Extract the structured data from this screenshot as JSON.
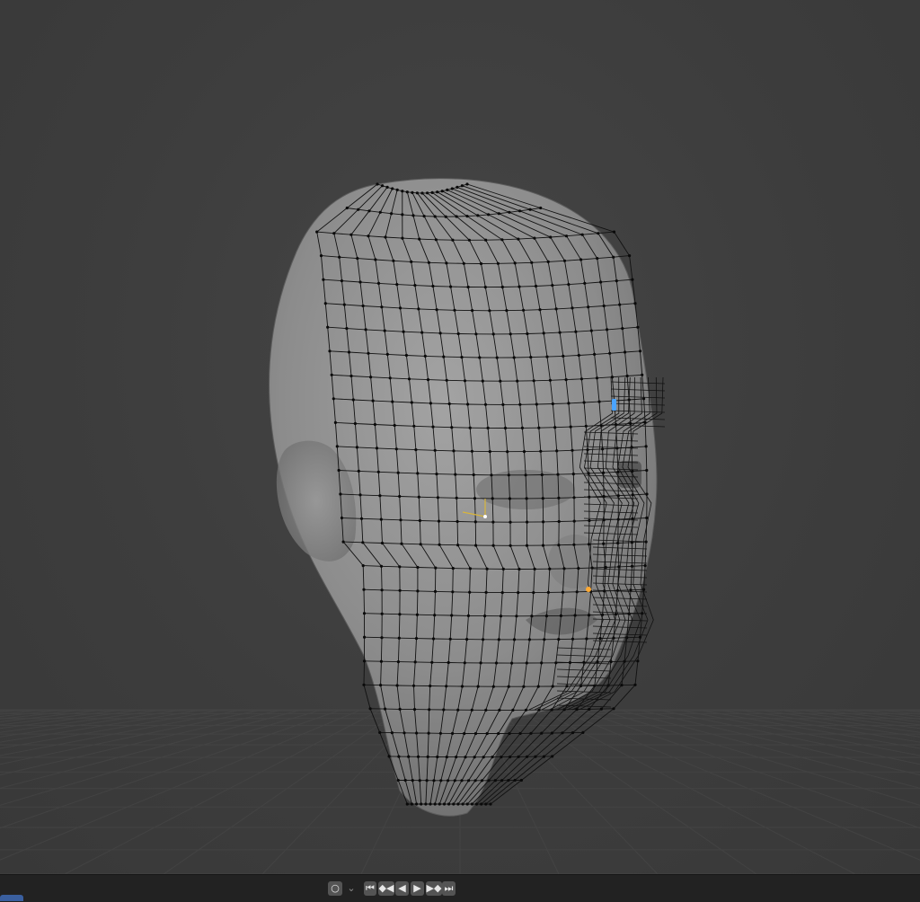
{
  "viewport": {
    "label": "",
    "background": "#3f3f3f",
    "mesh_colors": {
      "skin": "#8e8e8e",
      "wire": "#111111",
      "active_vertex": "#4aa3ff",
      "selected_vertex": "#ffaa33",
      "cursor_axis": "#d9b53b"
    }
  },
  "timeline": {
    "buttons": [
      {
        "name": "record-toggle-icon",
        "glyph": "○"
      },
      {
        "name": "keying-dropdown-icon",
        "glyph": "⌄"
      },
      {
        "name": "jump-to-start-icon",
        "glyph": "⏮"
      },
      {
        "name": "jump-to-previous-keyframe-icon",
        "glyph": "◆◀"
      },
      {
        "name": "play-reverse-icon",
        "glyph": "◀"
      },
      {
        "name": "play-icon",
        "glyph": "▶"
      },
      {
        "name": "jump-to-next-keyframe-icon",
        "glyph": "▶◆"
      },
      {
        "name": "jump-to-end-icon",
        "glyph": "⏭"
      }
    ]
  }
}
